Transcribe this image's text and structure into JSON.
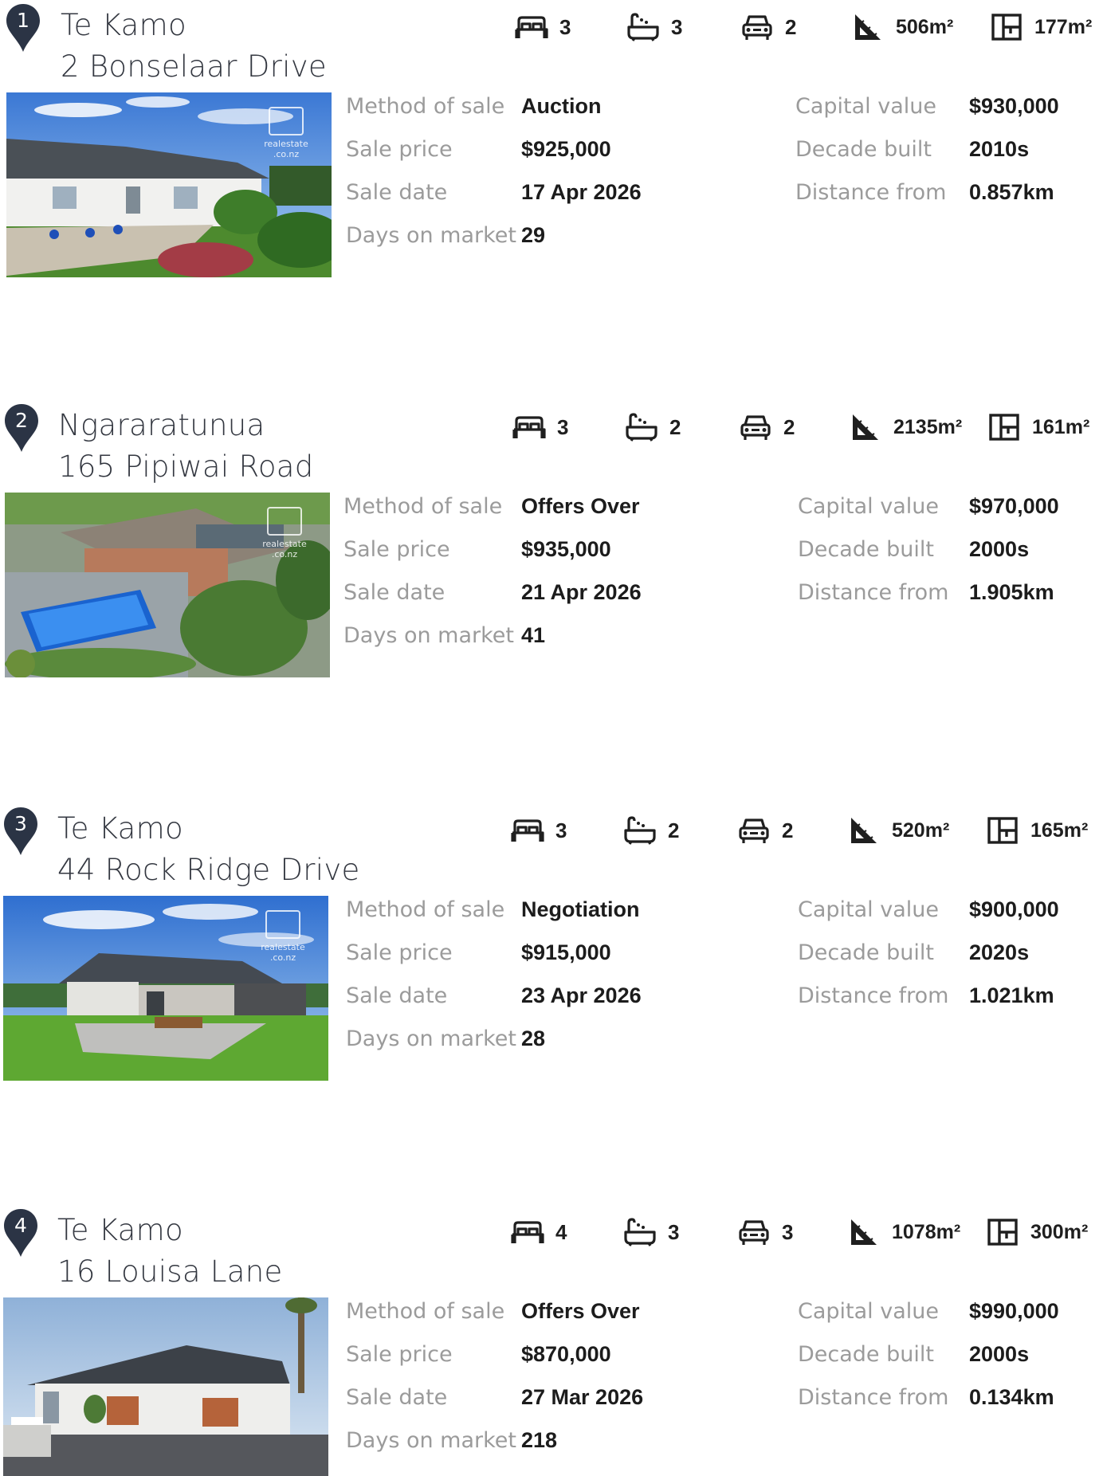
{
  "listings": [
    {
      "number": "1",
      "suburb": "Te Kamo",
      "address": "2 Bonselaar Drive",
      "bedrooms": "3",
      "bathrooms": "3",
      "garages": "2",
      "land_area": "506m²",
      "floor_area": "177m²",
      "photo_watermark": "realestate",
      "photo_watermark_sub": ".co.nz",
      "method_of_sale_label": "Method of sale",
      "method_of_sale": "Auction",
      "sale_price_label": "Sale price",
      "sale_price": "$925,000",
      "sale_date_label": "Sale date",
      "sale_date": "17 Apr 2026",
      "days_on_market_label": "Days on market",
      "days_on_market": "29",
      "capital_value_label": "Capital value",
      "capital_value": "$930,000",
      "decade_built_label": "Decade built",
      "decade_built": "2010s",
      "distance_from_label": "Distance from",
      "distance_from": "0.857km"
    },
    {
      "number": "2",
      "suburb": "Ngararatunua",
      "address": "165 Pipiwai Road",
      "bedrooms": "3",
      "bathrooms": "2",
      "garages": "2",
      "land_area": "2135m²",
      "floor_area": "161m²",
      "photo_watermark": "realestate",
      "photo_watermark_sub": ".co.nz",
      "method_of_sale_label": "Method of sale",
      "method_of_sale": "Offers Over",
      "sale_price_label": "Sale price",
      "sale_price": "$935,000",
      "sale_date_label": "Sale date",
      "sale_date": "21 Apr 2026",
      "days_on_market_label": "Days on market",
      "days_on_market": "41",
      "capital_value_label": "Capital value",
      "capital_value": "$970,000",
      "decade_built_label": "Decade built",
      "decade_built": "2000s",
      "distance_from_label": "Distance from",
      "distance_from": "1.905km"
    },
    {
      "number": "3",
      "suburb": "Te Kamo",
      "address": "44 Rock Ridge Drive",
      "bedrooms": "3",
      "bathrooms": "2",
      "garages": "2",
      "land_area": "520m²",
      "floor_area": "165m²",
      "photo_watermark": "realestate",
      "photo_watermark_sub": ".co.nz",
      "method_of_sale_label": "Method of sale",
      "method_of_sale": "Negotiation",
      "sale_price_label": "Sale price",
      "sale_price": "$915,000",
      "sale_date_label": "Sale date",
      "sale_date": "23 Apr 2026",
      "days_on_market_label": "Days on market",
      "days_on_market": "28",
      "capital_value_label": "Capital value",
      "capital_value": "$900,000",
      "decade_built_label": "Decade built",
      "decade_built": "2020s",
      "distance_from_label": "Distance from",
      "distance_from": "1.021km"
    },
    {
      "number": "4",
      "suburb": "Te Kamo",
      "address": "16 Louisa Lane",
      "bedrooms": "4",
      "bathrooms": "3",
      "garages": "3",
      "land_area": "1078m²",
      "floor_area": "300m²",
      "photo_watermark": "",
      "photo_watermark_sub": "",
      "method_of_sale_label": "Method of sale",
      "method_of_sale": "Offers Over",
      "sale_price_label": "Sale price",
      "sale_price": "$870,000",
      "sale_date_label": "Sale date",
      "sale_date": "27 Mar 2026",
      "days_on_market_label": "Days on market",
      "days_on_market": "218",
      "capital_value_label": "Capital value",
      "capital_value": "$990,000",
      "decade_built_label": "Decade built",
      "decade_built": "2000s",
      "distance_from_label": "Distance from",
      "distance_from": "0.134km"
    }
  ],
  "icons": {
    "pin": "map-pin-icon",
    "bedrooms": "bed-icon",
    "bathrooms": "bath-icon",
    "garages": "car-icon",
    "land_area": "land-area-icon",
    "floor_area": "floor-plan-icon"
  },
  "colors": {
    "pin": "#2b3445",
    "label": "#9b9b9b",
    "value": "#1c1c1c",
    "heading": "#333740"
  }
}
